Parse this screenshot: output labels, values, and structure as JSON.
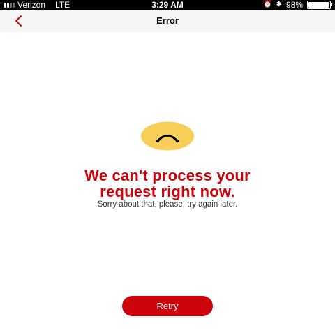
{
  "status_bar": {
    "carrier": "Verizon",
    "network": "LTE",
    "time": "3:29 AM",
    "battery": "98%",
    "battery_level": 0.98,
    "icons": [
      "alarm-icon",
      "bluetooth-icon"
    ]
  },
  "nav": {
    "back_icon": "chevron-left-icon",
    "title": "Error"
  },
  "error": {
    "icon": "sad-face-icon",
    "headline_line1": "We can't process your",
    "headline_line2": "request right now.",
    "message": "Sorry about that, please, try again later."
  },
  "actions": {
    "retry_label": "Retry"
  },
  "colors": {
    "accent": "#cd040b",
    "face": "#f7cf58",
    "nav_background": "#f6f6f6",
    "status_background": "#000000"
  }
}
